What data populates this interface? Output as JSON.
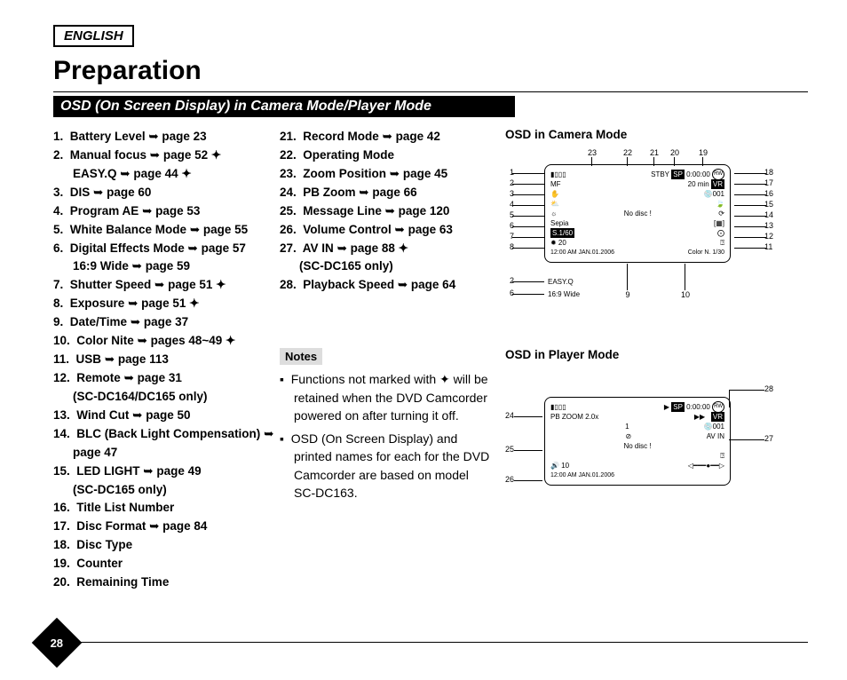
{
  "language_label": "ENGLISH",
  "page_title": "Preparation",
  "section_title": "OSD (On Screen Display) in Camera Mode/Player Mode",
  "page_number": "28",
  "osd_items": [
    {
      "n": 1,
      "text": "Battery Level",
      "page": "page 23"
    },
    {
      "n": 2,
      "text": "Manual focus",
      "page": "page 52",
      "star": true,
      "sub": {
        "text": "EASY.Q",
        "page": "page 44",
        "star": true
      }
    },
    {
      "n": 3,
      "text": "DIS",
      "page": "page 60"
    },
    {
      "n": 4,
      "text": "Program AE",
      "page": "page 53"
    },
    {
      "n": 5,
      "text": "White Balance Mode",
      "page": "page 55"
    },
    {
      "n": 6,
      "text": "Digital Effects Mode",
      "page": "page 57",
      "sub": {
        "text": "16:9 Wide",
        "page": "page 59"
      }
    },
    {
      "n": 7,
      "text": "Shutter Speed",
      "page": "page 51",
      "star": true
    },
    {
      "n": 8,
      "text": "Exposure",
      "page": "page 51",
      "star": true
    },
    {
      "n": 9,
      "text": "Date/Time",
      "page": "page 37"
    },
    {
      "n": 10,
      "text": "Color Nite",
      "page": "pages 48~49",
      "star": true
    },
    {
      "n": 11,
      "text": "USB",
      "page": "page 113"
    },
    {
      "n": 12,
      "text": "Remote",
      "page": "page 31",
      "note": "(SC-DC164/DC165 only)"
    },
    {
      "n": 13,
      "text": "Wind Cut",
      "page": "page 50"
    },
    {
      "n": 14,
      "text": "BLC (Back Light Compensation)",
      "page": "page 47"
    },
    {
      "n": 15,
      "text": "LED LIGHT",
      "page": "page 49",
      "note": "(SC-DC165 only)"
    },
    {
      "n": 16,
      "text": "Title List Number"
    },
    {
      "n": 17,
      "text": "Disc Format",
      "page": "page 84"
    },
    {
      "n": 18,
      "text": "Disc Type"
    },
    {
      "n": 19,
      "text": "Counter"
    },
    {
      "n": 20,
      "text": "Remaining Time"
    },
    {
      "n": 21,
      "text": "Record Mode",
      "page": "page 42"
    },
    {
      "n": 22,
      "text": "Operating Mode"
    },
    {
      "n": 23,
      "text": "Zoom Position",
      "page": "page 45"
    },
    {
      "n": 24,
      "text": "PB Zoom",
      "page": "page 66"
    },
    {
      "n": 25,
      "text": "Message Line",
      "page": "page 120"
    },
    {
      "n": 26,
      "text": "Volume Control",
      "page": "page 63"
    },
    {
      "n": 27,
      "text": "AV IN",
      "page": "page 88",
      "star": true,
      "note": "(SC-DC165 only)"
    },
    {
      "n": 28,
      "text": "Playback Speed",
      "page": "page 64"
    }
  ],
  "notes_header": "Notes",
  "notes": [
    "Functions not marked with ✦ will be retained when the DVD Camcorder powered on after turning it off.",
    "OSD (On Screen Display) and printed names for each for the DVD Camcorder are based on model SC-DC163."
  ],
  "figures": {
    "camera": {
      "title": "OSD in Camera Mode",
      "callouts_top": [
        "23",
        "22",
        "21",
        "20",
        "19"
      ],
      "callouts_left": [
        "1",
        "2",
        "3",
        "4",
        "5",
        "6",
        "7",
        "8",
        "2",
        "6"
      ],
      "callouts_right": [
        "18",
        "17",
        "16",
        "15",
        "14",
        "13",
        "12",
        "11"
      ],
      "callouts_bottom": [
        "9",
        "10"
      ],
      "screen": {
        "r1": {
          "left_icons": "▮▯▯▯",
          "stby": "STBY",
          "sp": "SP",
          "time": "0:00:00",
          "rw": "RW"
        },
        "r2": {
          "mf": "MF",
          "mins": "20 min",
          "vr": "VR"
        },
        "r3": {
          "hand_icon": "✋",
          "disc_icon": "💿",
          "num": "001"
        },
        "r4": {
          "ae_icon": "⛅",
          "leaf_icon": "🍃"
        },
        "r5": {
          "wb_icon": "☼",
          "nodisc": "No disc !",
          "wind_icon": "⟳"
        },
        "r6": {
          "text": "Sepia",
          "blc_icon": "[▦]"
        },
        "r7": {
          "shutter": "S.1/60",
          "led_icon": "⨀"
        },
        "r8": {
          "exp": "✹ 20",
          "remote_icon": "⍰"
        },
        "r9": {
          "datetime": "12:00 AM JAN.01.2006",
          "colornite": "Color N. 1/30"
        },
        "r10": {
          "easyq": "EASY.Q"
        },
        "r11": {
          "wide": "16:9 Wide"
        }
      }
    },
    "player": {
      "title": "OSD in Player Mode",
      "callouts_left": [
        "24",
        "25",
        "26"
      ],
      "callouts_right": [
        "28",
        "27"
      ],
      "screen": {
        "r1": {
          "left_icons": "▮▯▯▯",
          "play": "▶",
          "sp": "SP",
          "time": "0:00:00",
          "rw": "RW"
        },
        "r2": {
          "pbzoom": "PB ZOOM 2.0x",
          "speed": "▶▶",
          "vr": "VR"
        },
        "r3": {
          "one": "1",
          "disc_icon": "💿",
          "num": "001"
        },
        "r4": {
          "slash": "⊘",
          "avin": "AV IN"
        },
        "r5": {
          "nodisc": "No disc !"
        },
        "r6": {
          "remote": "⍰"
        },
        "r7": {
          "vol": "🔊 10",
          "bar": "◁━━━●━━▷"
        },
        "r8": {
          "datetime": "12:00 AM JAN.01.2006"
        }
      }
    }
  }
}
